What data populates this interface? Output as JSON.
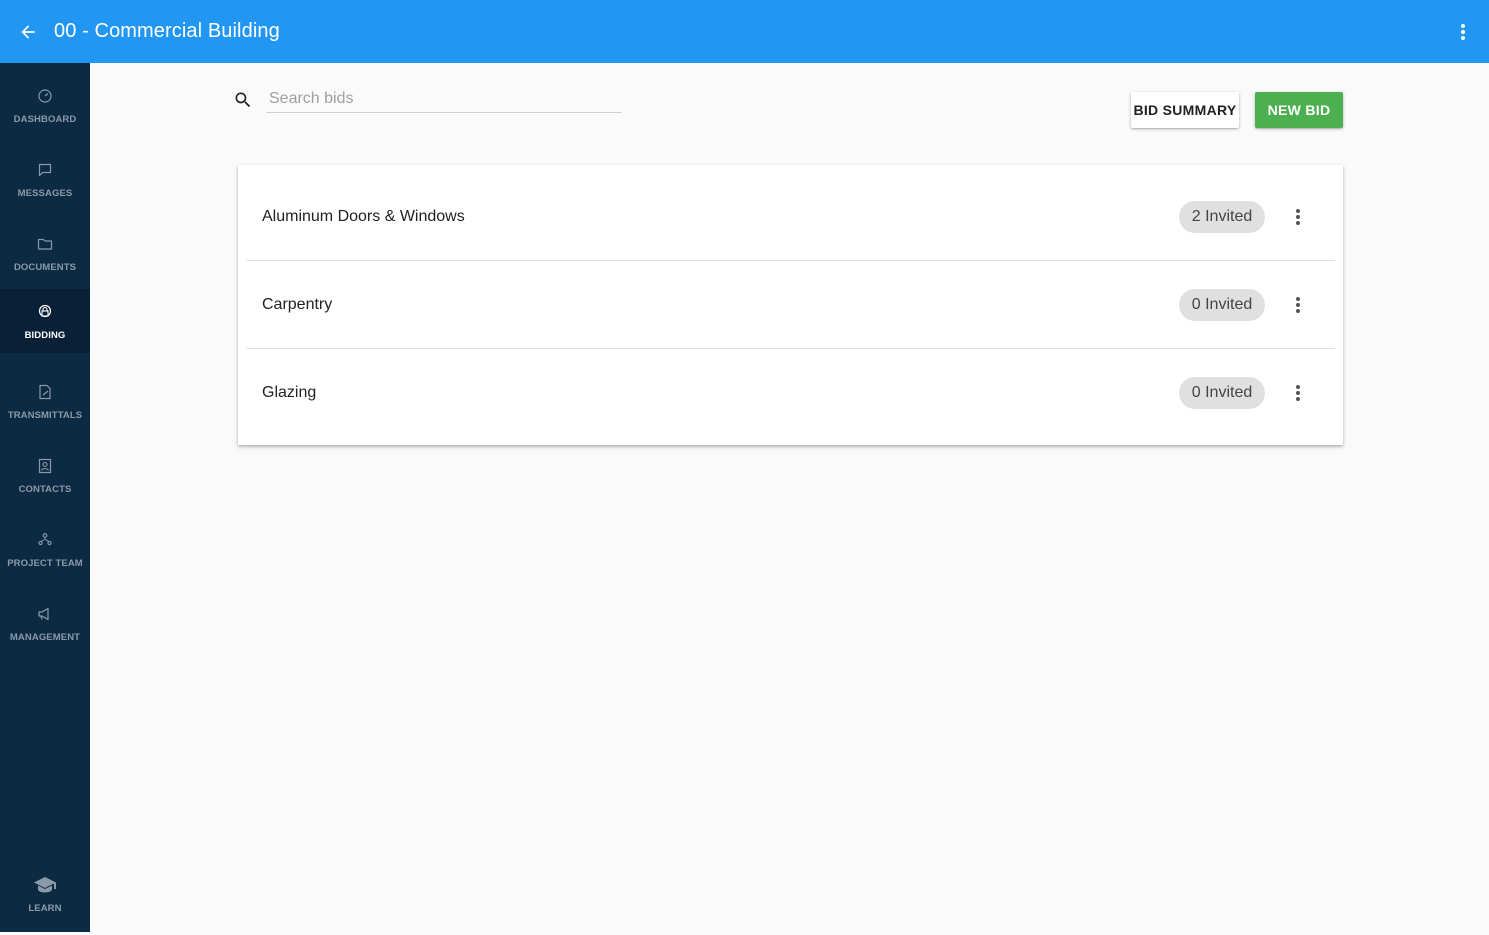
{
  "appbar": {
    "title": "00 - Commercial Building",
    "back_icon": "arrow-back-icon",
    "menu_icon": "more-vert-icon"
  },
  "sidebar": {
    "items": [
      {
        "label": "DASHBOARD",
        "icon": "dashboard-icon",
        "active": false
      },
      {
        "label": "MESSAGES",
        "icon": "message-icon",
        "active": false
      },
      {
        "label": "DOCUMENTS",
        "icon": "folder-icon",
        "active": false
      },
      {
        "label": "BIDDING",
        "icon": "bidding-icon",
        "active": true
      },
      {
        "label": "TRANSMITTALS",
        "icon": "transmittal-icon",
        "active": false
      },
      {
        "label": "CONTACTS",
        "icon": "contacts-icon",
        "active": false
      },
      {
        "label": "PROJECT TEAM",
        "icon": "team-icon",
        "active": false
      },
      {
        "label": "MANAGEMENT",
        "icon": "megaphone-icon",
        "active": false
      }
    ],
    "learn": {
      "label": "LEARN",
      "icon": "graduation-cap-icon"
    }
  },
  "search": {
    "placeholder": "Search bids",
    "value": ""
  },
  "toolbar": {
    "bid_summary_label": "BID SUMMARY",
    "new_bid_label": "NEW BID"
  },
  "bids": [
    {
      "name": "Aluminum Doors & Windows",
      "invited": "2 Invited"
    },
    {
      "name": "Carpentry",
      "invited": "0 Invited"
    },
    {
      "name": "Glazing",
      "invited": "0 Invited"
    }
  ],
  "colors": {
    "appbar": "#2196f3",
    "sidebar": "#0d2a43",
    "new_bid": "#4caf50"
  }
}
